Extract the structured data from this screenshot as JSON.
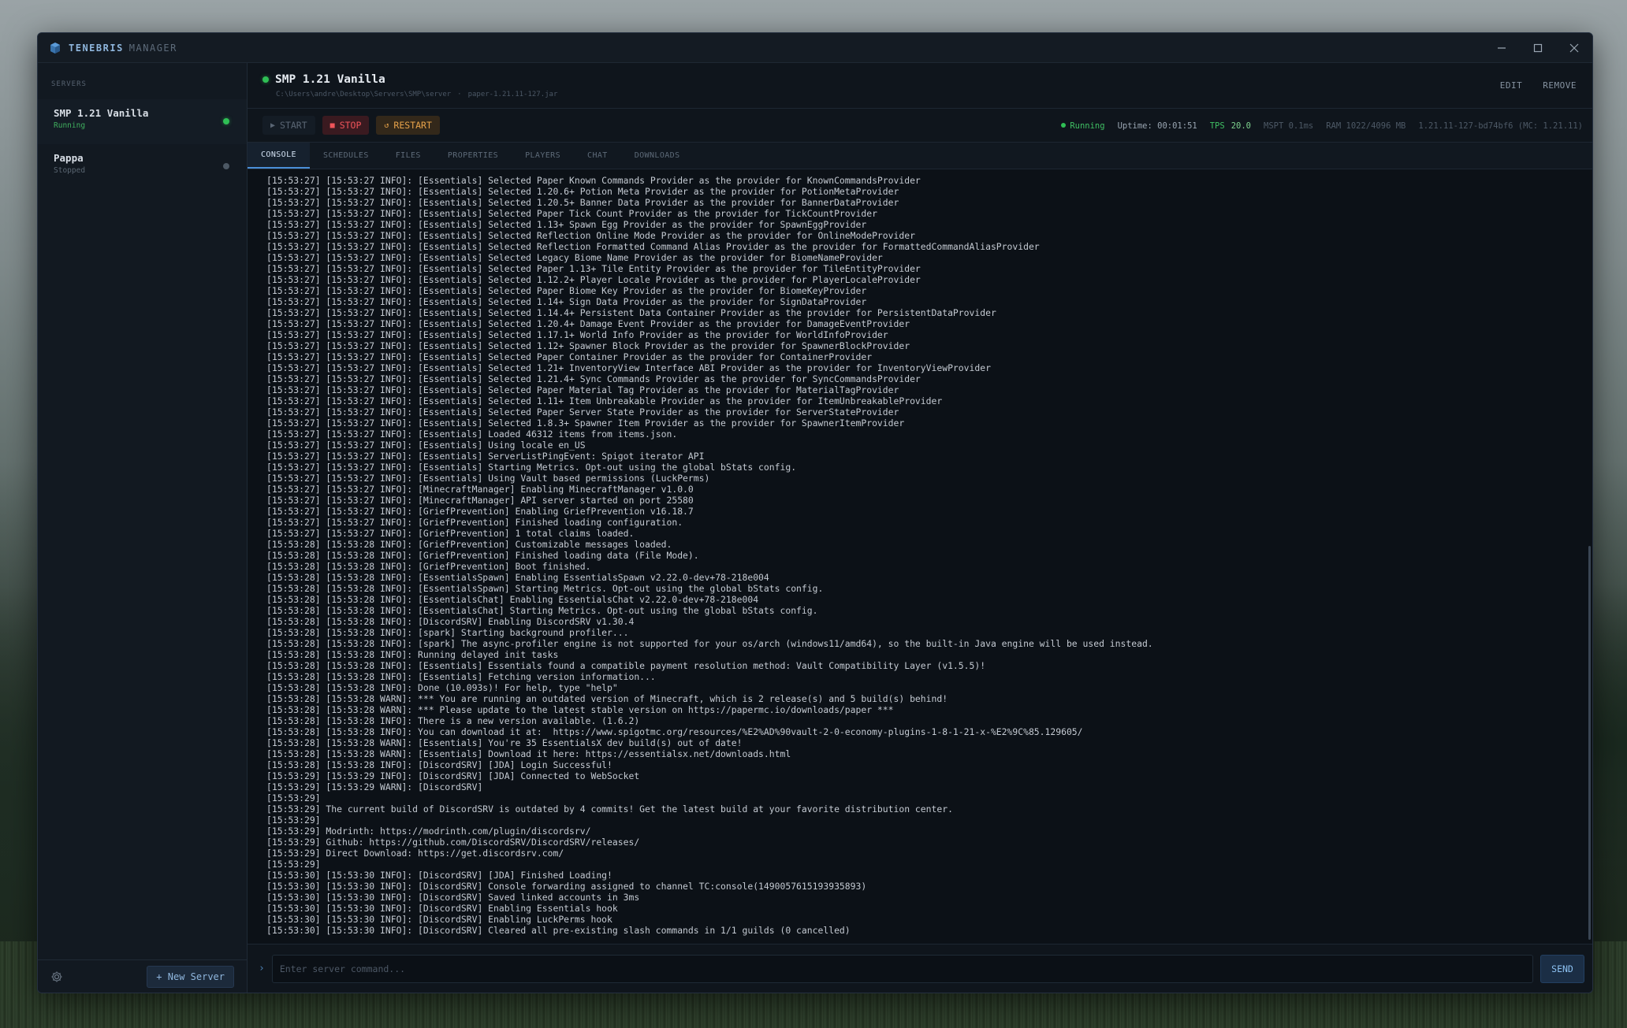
{
  "app": {
    "name_primary": "TENEBRIS",
    "name_secondary": "MANAGER"
  },
  "sidebar": {
    "section_label": "SERVERS",
    "servers": [
      {
        "name": "SMP 1.21 Vanilla",
        "status": "Running"
      },
      {
        "name": "Pappa",
        "status": "Stopped"
      }
    ],
    "new_server_label": "+ New Server"
  },
  "server": {
    "title": "SMP 1.21 Vanilla",
    "path": "C:\\Users\\andre\\Desktop\\Servers\\SMP\\server",
    "path_sep": "·",
    "jar": "paper-1.21.11-127.jar",
    "edit_label": "EDIT",
    "remove_label": "REMOVE"
  },
  "controls": {
    "start": "START",
    "stop": "STOP",
    "restart": "RESTART"
  },
  "stats": {
    "status": "Running",
    "uptime": "Uptime: 00:01:51",
    "tps_label": "TPS",
    "tps_value": "20.0",
    "mspt": "MSPT  0.1ms",
    "ram": "RAM  1022/4096 MB",
    "version": "1.21.11-127-bd74bf6 (MC: 1.21.11)"
  },
  "tabs": [
    "CONSOLE",
    "SCHEDULES",
    "FILES",
    "PROPERTIES",
    "PLAYERS",
    "CHAT",
    "DOWNLOADS"
  ],
  "console": {
    "lines": [
      "[15:53:27] [15:53:27 INFO]: [Essentials] Selected Paper Known Commands Provider as the provider for KnownCommandsProvider",
      "[15:53:27] [15:53:27 INFO]: [Essentials] Selected 1.20.6+ Potion Meta Provider as the provider for PotionMetaProvider",
      "[15:53:27] [15:53:27 INFO]: [Essentials] Selected 1.20.5+ Banner Data Provider as the provider for BannerDataProvider",
      "[15:53:27] [15:53:27 INFO]: [Essentials] Selected Paper Tick Count Provider as the provider for TickCountProvider",
      "[15:53:27] [15:53:27 INFO]: [Essentials] Selected 1.13+ Spawn Egg Provider as the provider for SpawnEggProvider",
      "[15:53:27] [15:53:27 INFO]: [Essentials] Selected Reflection Online Mode Provider as the provider for OnlineModeProvider",
      "[15:53:27] [15:53:27 INFO]: [Essentials] Selected Reflection Formatted Command Alias Provider as the provider for FormattedCommandAliasProvider",
      "[15:53:27] [15:53:27 INFO]: [Essentials] Selected Legacy Biome Name Provider as the provider for BiomeNameProvider",
      "[15:53:27] [15:53:27 INFO]: [Essentials] Selected Paper 1.13+ Tile Entity Provider as the provider for TileEntityProvider",
      "[15:53:27] [15:53:27 INFO]: [Essentials] Selected 1.12.2+ Player Locale Provider as the provider for PlayerLocaleProvider",
      "[15:53:27] [15:53:27 INFO]: [Essentials] Selected Paper Biome Key Provider as the provider for BiomeKeyProvider",
      "[15:53:27] [15:53:27 INFO]: [Essentials] Selected 1.14+ Sign Data Provider as the provider for SignDataProvider",
      "[15:53:27] [15:53:27 INFO]: [Essentials] Selected 1.14.4+ Persistent Data Container Provider as the provider for PersistentDataProvider",
      "[15:53:27] [15:53:27 INFO]: [Essentials] Selected 1.20.4+ Damage Event Provider as the provider for DamageEventProvider",
      "[15:53:27] [15:53:27 INFO]: [Essentials] Selected 1.17.1+ World Info Provider as the provider for WorldInfoProvider",
      "[15:53:27] [15:53:27 INFO]: [Essentials] Selected 1.12+ Spawner Block Provider as the provider for SpawnerBlockProvider",
      "[15:53:27] [15:53:27 INFO]: [Essentials] Selected Paper Container Provider as the provider for ContainerProvider",
      "[15:53:27] [15:53:27 INFO]: [Essentials] Selected 1.21+ InventoryView Interface ABI Provider as the provider for InventoryViewProvider",
      "[15:53:27] [15:53:27 INFO]: [Essentials] Selected 1.21.4+ Sync Commands Provider as the provider for SyncCommandsProvider",
      "[15:53:27] [15:53:27 INFO]: [Essentials] Selected Paper Material Tag Provider as the provider for MaterialTagProvider",
      "[15:53:27] [15:53:27 INFO]: [Essentials] Selected 1.11+ Item Unbreakable Provider as the provider for ItemUnbreakableProvider",
      "[15:53:27] [15:53:27 INFO]: [Essentials] Selected Paper Server State Provider as the provider for ServerStateProvider",
      "[15:53:27] [15:53:27 INFO]: [Essentials] Selected 1.8.3+ Spawner Item Provider as the provider for SpawnerItemProvider",
      "[15:53:27] [15:53:27 INFO]: [Essentials] Loaded 46312 items from items.json.",
      "[15:53:27] [15:53:27 INFO]: [Essentials] Using locale en_US",
      "[15:53:27] [15:53:27 INFO]: [Essentials] ServerListPingEvent: Spigot iterator API",
      "[15:53:27] [15:53:27 INFO]: [Essentials] Starting Metrics. Opt-out using the global bStats config.",
      "[15:53:27] [15:53:27 INFO]: [Essentials] Using Vault based permissions (LuckPerms)",
      "[15:53:27] [15:53:27 INFO]: [MinecraftManager] Enabling MinecraftManager v1.0.0",
      "[15:53:27] [15:53:27 INFO]: [MinecraftManager] API server started on port 25580",
      "[15:53:27] [15:53:27 INFO]: [GriefPrevention] Enabling GriefPrevention v16.18.7",
      "[15:53:27] [15:53:27 INFO]: [GriefPrevention] Finished loading configuration.",
      "[15:53:27] [15:53:27 INFO]: [GriefPrevention] 1 total claims loaded.",
      "[15:53:28] [15:53:28 INFO]: [GriefPrevention] Customizable messages loaded.",
      "[15:53:28] [15:53:28 INFO]: [GriefPrevention] Finished loading data (File Mode).",
      "[15:53:28] [15:53:28 INFO]: [GriefPrevention] Boot finished.",
      "[15:53:28] [15:53:28 INFO]: [EssentialsSpawn] Enabling EssentialsSpawn v2.22.0-dev+78-218e004",
      "[15:53:28] [15:53:28 INFO]: [EssentialsSpawn] Starting Metrics. Opt-out using the global bStats config.",
      "[15:53:28] [15:53:28 INFO]: [EssentialsChat] Enabling EssentialsChat v2.22.0-dev+78-218e004",
      "[15:53:28] [15:53:28 INFO]: [EssentialsChat] Starting Metrics. Opt-out using the global bStats config.",
      "[15:53:28] [15:53:28 INFO]: [DiscordSRV] Enabling DiscordSRV v1.30.4",
      "[15:53:28] [15:53:28 INFO]: [spark] Starting background profiler...",
      "[15:53:28] [15:53:28 INFO]: [spark] The async-profiler engine is not supported for your os/arch (windows11/amd64), so the built-in Java engine will be used instead.",
      "[15:53:28] [15:53:28 INFO]: Running delayed init tasks",
      "[15:53:28] [15:53:28 INFO]: [Essentials] Essentials found a compatible payment resolution method: Vault Compatibility Layer (v1.5.5)!",
      "[15:53:28] [15:53:28 INFO]: [Essentials] Fetching version information...",
      "[15:53:28] [15:53:28 INFO]: Done (10.093s)! For help, type \"help\"",
      "[15:53:28] [15:53:28 WARN]: *** You are running an outdated version of Minecraft, which is 2 release(s) and 5 build(s) behind!",
      "[15:53:28] [15:53:28 WARN]: *** Please update to the latest stable version on https://papermc.io/downloads/paper ***",
      "[15:53:28] [15:53:28 INFO]: There is a new version available. (1.6.2)",
      "[15:53:28] [15:53:28 INFO]: You can download it at:  https://www.spigotmc.org/resources/%E2%AD%90vault-2-0-economy-plugins-1-8-1-21-x-%E2%9C%85.129605/",
      "[15:53:28] [15:53:28 WARN]: [Essentials] You're 35 EssentialsX dev build(s) out of date!",
      "[15:53:28] [15:53:28 WARN]: [Essentials] Download it here: https://essentialsx.net/downloads.html",
      "[15:53:28] [15:53:28 INFO]: [DiscordSRV] [JDA] Login Successful!",
      "[15:53:29] [15:53:29 INFO]: [DiscordSRV] [JDA] Connected to WebSocket",
      "[15:53:29] [15:53:29 WARN]: [DiscordSRV]",
      "[15:53:29]",
      "[15:53:29] The current build of DiscordSRV is outdated by 4 commits! Get the latest build at your favorite distribution center.",
      "[15:53:29]",
      "[15:53:29] Modrinth: https://modrinth.com/plugin/discordsrv/",
      "[15:53:29] Github: https://github.com/DiscordSRV/DiscordSRV/releases/",
      "[15:53:29] Direct Download: https://get.discordsrv.com/",
      "[15:53:29]",
      "[15:53:30] [15:53:30 INFO]: [DiscordSRV] [JDA] Finished Loading!",
      "[15:53:30] [15:53:30 INFO]: [DiscordSRV] Console forwarding assigned to channel TC:console(1490057615193935893)",
      "[15:53:30] [15:53:30 INFO]: [DiscordSRV] Saved linked accounts in 3ms",
      "[15:53:30] [15:53:30 INFO]: [DiscordSRV] Enabling Essentials hook",
      "[15:53:30] [15:53:30 INFO]: [DiscordSRV] Enabling LuckPerms hook",
      "[15:53:30] [15:53:30 INFO]: [DiscordSRV] Cleared all pre-existing slash commands in 1/1 guilds (0 cancelled)"
    ]
  },
  "command": {
    "placeholder": "Enter server command...",
    "send_label": "SEND"
  }
}
